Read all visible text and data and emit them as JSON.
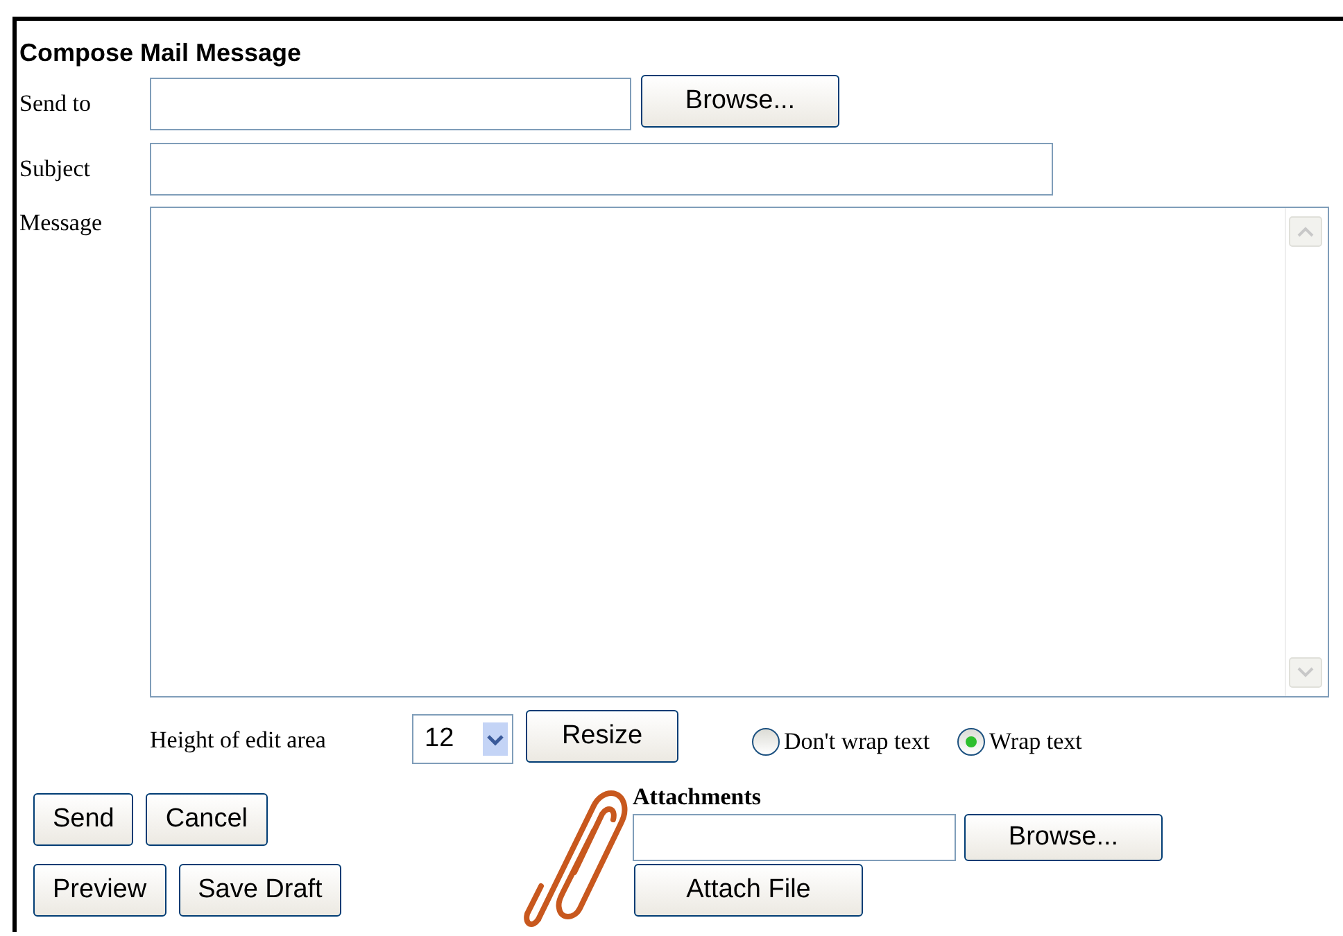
{
  "title": "Compose Mail Message",
  "send_to": {
    "label": "Send to",
    "button": "Browse..."
  },
  "subject": {
    "label": "Subject"
  },
  "message": {
    "label": "Message"
  },
  "edit_height": {
    "label": "Height of edit area",
    "value": "12",
    "button": "Resize"
  },
  "wrap_options": [
    {
      "label": "Don't wrap text",
      "selected": false
    },
    {
      "label": "Wrap text",
      "selected": true
    }
  ],
  "action_rows": [
    [
      "Send",
      "Cancel"
    ],
    [
      "Preview",
      "Save Draft"
    ]
  ],
  "attachments": {
    "label": "Attachments",
    "browse_button": "Browse...",
    "attach_button": "Attach File"
  }
}
